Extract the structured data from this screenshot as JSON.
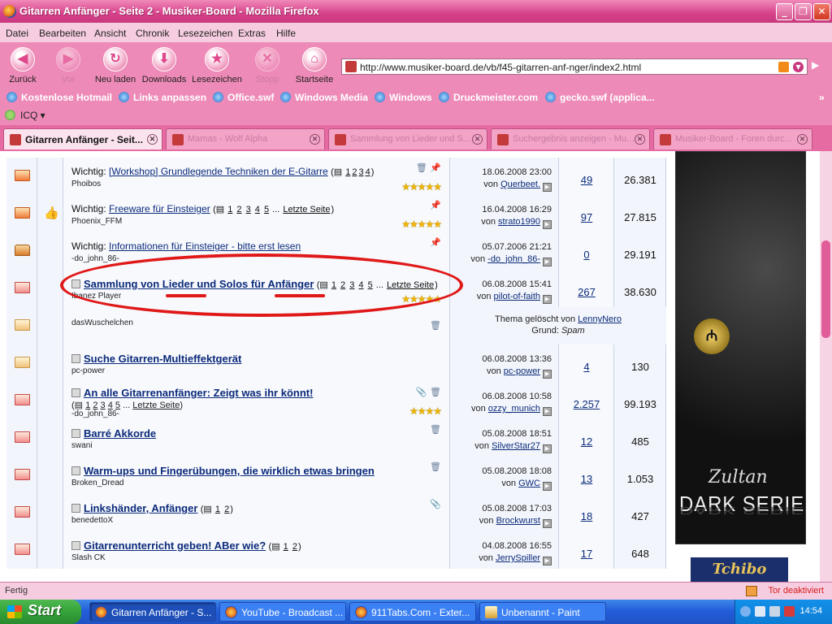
{
  "window": {
    "title": "Gitarren Anfänger - Seite 2 - Musiker-Board - Mozilla Firefox"
  },
  "menu": [
    "Datei",
    "Bearbeiten",
    "Ansicht",
    "Chronik",
    "Lesezeichen",
    "Extras",
    "Hilfe"
  ],
  "nav": {
    "back": "Zurück",
    "forward": "Vor",
    "reload": "Neu laden",
    "downloads": "Downloads",
    "bookmarks": "Lesezeichen",
    "stop": "Stopp",
    "home": "Startseite"
  },
  "address": {
    "url": "http://www.musiker-board.de/vb/f45-gitarren-anf-nger/index2.html"
  },
  "bookmarks": [
    "Kostenlose Hotmail",
    "Links anpassen",
    "Office.swf",
    "Windows Media",
    "Windows",
    "Druckmeister.com",
    "gecko.swf (applica..."
  ],
  "icq": {
    "label": "ICQ"
  },
  "tabs": [
    {
      "label": "Gitarren Anfänger - Seit...",
      "active": true
    },
    {
      "label": "Mamas - Wolf Alpha",
      "active": false
    },
    {
      "label": "Sammlung von Lieder und S...",
      "active": false
    },
    {
      "label": "Suchergebnis anzeigen - Mu...",
      "active": false
    },
    {
      "label": "Musiker-Board - Foren durc...",
      "active": false
    }
  ],
  "threads": [
    {
      "prefix": "Wichtig: ",
      "title": "[Workshop] Grundlegende Techniken der E-Gitarre",
      "pages": [
        "1",
        "2",
        "3",
        "4"
      ],
      "author": "Phoibos",
      "date": "18.06.2008",
      "time": "23:00",
      "by_prefix": "von ",
      "last_by": "Querbeet.",
      "replies": "49",
      "views": "26.381",
      "stars": "★★★★★"
    },
    {
      "prefix": "Wichtig: ",
      "title": "Freeware für Einsteiger",
      "pages": [
        "1",
        "2",
        "3",
        "4",
        "5"
      ],
      "last_page": "Letzte Seite",
      "author": "Phoenix_FFM",
      "date": "16.04.2008",
      "time": "16:29",
      "by_prefix": "von ",
      "last_by": "strato1990",
      "replies": "97",
      "views": "27.815",
      "stars": "★★★★★"
    },
    {
      "prefix": "Wichtig: ",
      "title": "Informationen für Einsteiger - bitte erst lesen",
      "author": "-do_john_86-",
      "date": "05.07.2006",
      "time": "21:21",
      "by_prefix": "von ",
      "last_by": "-do_john_86-",
      "replies": "0",
      "views": "29.191"
    },
    {
      "title": "Sammlung von Lieder und Solos für Anfänger",
      "pages": [
        "1",
        "2",
        "3",
        "4",
        "5"
      ],
      "last_page": "Letzte Seite",
      "author": "Ibanez Player",
      "date": "06.08.2008",
      "time": "15:41",
      "by_prefix": "von ",
      "last_by": "pilot-of-faith",
      "replies": "267",
      "views": "38.630",
      "stars": "★★★★★"
    },
    {
      "author": "dasWuschelchen",
      "deleted_text": "Thema gelöscht von ",
      "deleted_by": "LennyNero",
      "reason_label": "Grund: ",
      "reason": "Spam"
    },
    {
      "title": "Suche Gitarren-Multieffektgerät",
      "author": "pc-power",
      "date": "06.08.2008",
      "time": "13:36",
      "by_prefix": "von ",
      "last_by": "pc-power",
      "replies": "4",
      "views": "130"
    },
    {
      "title": "An alle Gitarrenanfänger: Zeigt was ihr könnt!",
      "pages": [
        "1",
        "2",
        "3",
        "4",
        "5"
      ],
      "last_page": "Letzte Seite",
      "author": "-do_john_86-",
      "date": "06.08.2008",
      "time": "10:58",
      "by_prefix": "von ",
      "last_by": "ozzy_munich",
      "replies": "2.257",
      "views": "99.193",
      "stars": "★★★★"
    },
    {
      "title": "Barré Akkorde",
      "author": "swani",
      "date": "05.08.2008",
      "time": "18:51",
      "by_prefix": "von ",
      "last_by": "SilverStar27",
      "replies": "12",
      "views": "485"
    },
    {
      "title": "Warm-ups und Fingerübungen, die wirklich etwas bringen",
      "author": "Broken_Dread",
      "date": "05.08.2008",
      "time": "18:08",
      "by_prefix": "von ",
      "last_by": "GWC",
      "replies": "13",
      "views": "1.053"
    },
    {
      "title": "Linkshänder, Anfänger",
      "pages": [
        "1",
        "2"
      ],
      "author": "benedettoX",
      "date": "05.08.2008",
      "time": "17:03",
      "by_prefix": "von ",
      "last_by": "Brockwurst",
      "replies": "18",
      "views": "427"
    },
    {
      "title": "Gitarrenunterricht geben! ABer wie?",
      "pages": [
        "1",
        "2"
      ],
      "author": "Slash CK",
      "date": "04.08.2008",
      "time": "16:55",
      "by_prefix": "von ",
      "last_by": "JerrySpiller",
      "replies": "17",
      "views": "648"
    }
  ],
  "ad": {
    "brand": "Zultan",
    "headline": "DARK SERIES",
    "tchibo": "Tchibo"
  },
  "status": {
    "left": "Fertig",
    "right": "Tor deaktiviert"
  },
  "taskbar": {
    "start": "Start",
    "tasks": [
      "Gitarren Anfänger - S...",
      "YouTube - Broadcast ...",
      "911Tabs.Com - Exter...",
      "Unbenannt - Paint"
    ],
    "clock": "14:54"
  }
}
